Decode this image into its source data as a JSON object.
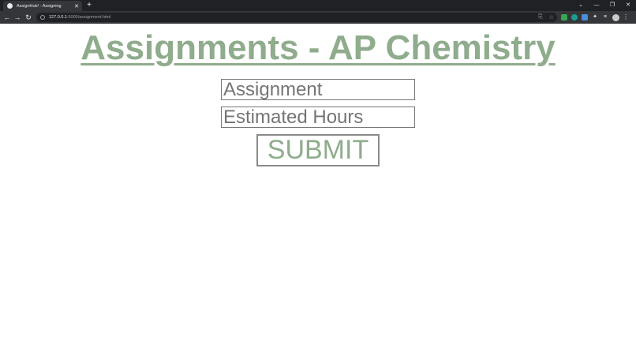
{
  "browser": {
    "tab_title": "AssignHub! - Assigning",
    "tab_close": "✕",
    "new_tab": "+",
    "url_host": "127.0.0.1",
    "url_path": ":5000/assignment.html",
    "window_controls": [
      "⌄",
      "—",
      "❐",
      "✕"
    ],
    "nav": {
      "back": "←",
      "forward": "→",
      "reload": "↻"
    }
  },
  "page": {
    "title": "Assignments - AP Chemistry",
    "assignment_placeholder": "Assignment",
    "hours_placeholder": "Estimated Hours",
    "submit_label": "SUBMIT"
  },
  "colors": {
    "accent_green": "#8fac8c",
    "chrome_dark": "#202124",
    "chrome_toolbar": "#35363a"
  }
}
